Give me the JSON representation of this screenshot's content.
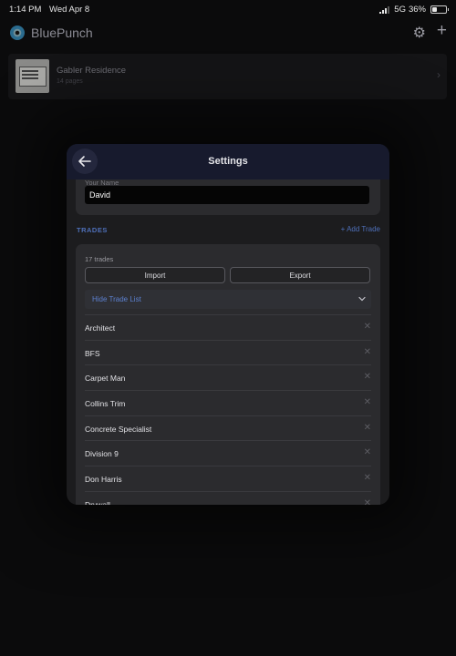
{
  "status_bar": {
    "time": "1:14 PM",
    "date": "Wed Apr 8",
    "network": "5G",
    "battery_percent": "36%",
    "battery_level": 0.36
  },
  "header": {
    "app_name": "BluePunch",
    "icons": [
      "app-logo",
      "gear-icon",
      "plus-icon"
    ]
  },
  "project": {
    "name": "Gabler Residence",
    "pages": "14 pages"
  },
  "settings": {
    "title": "Settings",
    "your_name_label": "Your Name",
    "your_name_value": "David",
    "trades_heading": "TRADES",
    "add_trade_label": "+ Add Trade",
    "trades_count": "17 trades",
    "import_label": "Import",
    "export_label": "Export",
    "hide_list_label": "Hide Trade List",
    "trades": [
      "Architect",
      "BFS",
      "Carpet Man",
      "Collins Trim",
      "Concrete Specialist",
      "Division 9",
      "Don Harris",
      "Drywall"
    ]
  },
  "colors": {
    "accent": "#4e6fb8",
    "modal_header": "#171a2d",
    "background": "#0b0b0c"
  }
}
